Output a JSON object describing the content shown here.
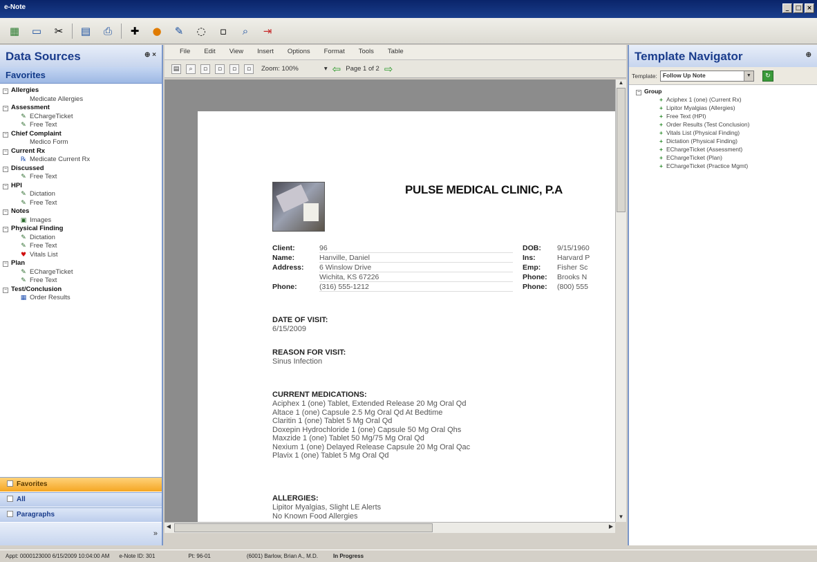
{
  "window": {
    "title": "e-Note"
  },
  "toolbar": {
    "icons": [
      "grid-icon",
      "window-icon",
      "tools-icon",
      "print-preview-icon",
      "printer-icon",
      "plus-icon",
      "settings-icon",
      "pen-icon",
      "blank-icon",
      "blank2-icon",
      "search-icon",
      "exit-icon"
    ]
  },
  "left_panel": {
    "title": "Data Sources",
    "section": "Favorites",
    "tree": [
      {
        "cat": "Allergies",
        "items": [
          {
            "label": "Medicate Allergies",
            "icon": "none"
          }
        ]
      },
      {
        "cat": "Assessment",
        "items": [
          {
            "label": "EChargeTicket",
            "icon": "pen"
          },
          {
            "label": "Free Text",
            "icon": "pen"
          }
        ]
      },
      {
        "cat": "Chief Complaint",
        "items": [
          {
            "label": "Medico Form",
            "icon": "none"
          }
        ]
      },
      {
        "cat": "Current Rx",
        "items": [
          {
            "label": "Medicate Current Rx",
            "icon": "rx"
          }
        ]
      },
      {
        "cat": "Discussed",
        "items": [
          {
            "label": "Free Text",
            "icon": "pen"
          }
        ]
      },
      {
        "cat": "HPI",
        "items": [
          {
            "label": "Dictation",
            "icon": "pen"
          },
          {
            "label": "Free Text",
            "icon": "pen"
          }
        ]
      },
      {
        "cat": "Notes",
        "items": [
          {
            "label": "Images",
            "icon": "image"
          }
        ]
      },
      {
        "cat": "Physical Finding",
        "items": [
          {
            "label": "Dictation",
            "icon": "pen"
          },
          {
            "label": "Free Text",
            "icon": "pen"
          },
          {
            "label": "Vitals List",
            "icon": "heart"
          }
        ]
      },
      {
        "cat": "Plan",
        "items": [
          {
            "label": "EChargeTicket",
            "icon": "pen"
          },
          {
            "label": "Free Text",
            "icon": "pen"
          }
        ]
      },
      {
        "cat": "Test/Conclusion",
        "items": [
          {
            "label": "Order Results",
            "icon": "order"
          }
        ]
      }
    ],
    "bottom_bars": {
      "favorites": "Favorites",
      "all": "All",
      "paragraphs": "Paragraphs"
    }
  },
  "center": {
    "menu": [
      "File",
      "Edit",
      "View",
      "Insert",
      "Options",
      "Format",
      "Tools",
      "Table"
    ],
    "docbar": {
      "zoom": "Zoom: 100%",
      "page": "Page 1 of 2"
    },
    "document": {
      "clinic_name": "PULSE MEDICAL CLINIC, P.A",
      "patient": {
        "client_label": "Client:",
        "client_value": "96",
        "name_label": "Name:",
        "name_value": "Hanville, Daniel",
        "address_label": "Address:",
        "address_line1": "6 Winslow Drive",
        "address_line2": "Wichita, KS 67226",
        "phone_label": "Phone:",
        "phone_value": "(316) 555-1212",
        "dob_label": "DOB:",
        "dob_value": "9/15/1960",
        "ins_label": "Ins:",
        "ins_value": "Harvard P",
        "emp_label": "Emp:",
        "emp_value": "Fisher Sc",
        "phone2_label": "Phone:",
        "phone2_value": "Brooks N",
        "phone3_label": "Phone:",
        "phone3_value": "(800) 555"
      },
      "date_of_visit": {
        "heading": "DATE OF VISIT:",
        "value": "6/15/2009"
      },
      "reason": {
        "heading": "REASON FOR VISIT:",
        "value": "Sinus Infection"
      },
      "medications": {
        "heading": "CURRENT MEDICATIONS:",
        "items": [
          "Aciphex 1 (one) Tablet, Extended Release 20 Mg Oral Qd",
          "Altace 1 (one) Capsule 2.5 Mg Oral Qd At Bedtime",
          "Claritin 1 (one) Tablet 5 Mg Oral Qd",
          "Doxepin Hydrochloride 1 (one) Capsule 50 Mg Oral Qhs",
          "Maxzide 1 (one) Tablet 50 Mg/75 Mg Oral Qd",
          "Nexium 1 (one) Delayed Release Capsule 20 Mg Oral Qac",
          "Plavix 1 (one) Tablet 5 Mg Oral Qd"
        ]
      },
      "allergies": {
        "heading": "ALLERGIES:",
        "items": [
          "Lipitor Myalgias, Slight LE Alerts",
          "No Known Food Allergies"
        ]
      }
    }
  },
  "right_panel": {
    "title": "Template Navigator",
    "template_label": "Template:",
    "template_value": "Follow Up Note",
    "group_label": "Group",
    "items": [
      "Aciphex 1 (one) (Current Rx)",
      "Lipitor Myalgias (Allergies)",
      "Free Text (HPI)",
      "Order Results (Test Conclusion)",
      "Vitals List (Physical Finding)",
      "Dictation (Physical Finding)",
      "EChargeTicket (Assessment)",
      "EChargeTicket (Plan)",
      "EChargeTicket (Practice Mgmt)"
    ]
  },
  "status": {
    "appt": "Appt: 0000123000 6/15/2009 10:04:00 AM",
    "enote_id": "e-Note ID: 301",
    "pt": "Pt: 96-01",
    "provider": "(6001) Barlow, Brian A., M.D.",
    "state": "In Progress"
  }
}
